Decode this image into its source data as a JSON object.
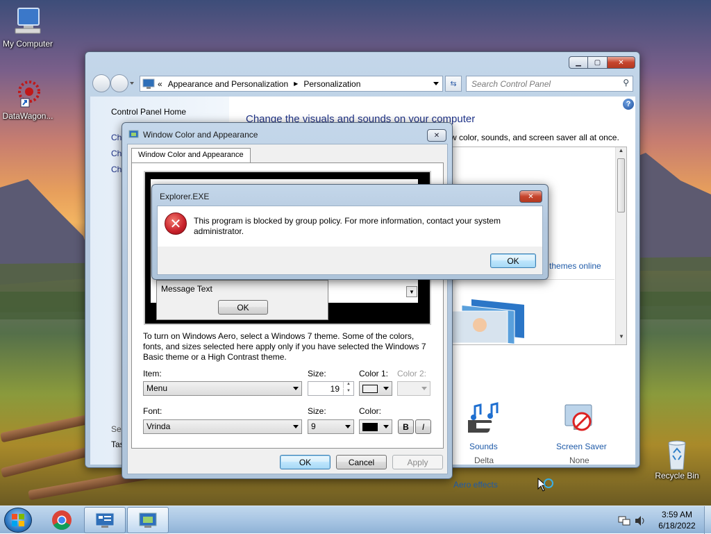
{
  "desktop": {
    "icons": [
      {
        "label": "My Computer",
        "icon": "computer-icon"
      },
      {
        "label": "DataWagon...",
        "icon": "datawagon-shortcut-icon"
      },
      {
        "label": "Recycle Bin",
        "icon": "recycle-bin-icon"
      }
    ]
  },
  "control_panel": {
    "address": {
      "prefix": "«",
      "crumb1": "Appearance and Personalization",
      "crumb2": "Personalization"
    },
    "search_placeholder": "Search Control Panel",
    "sidebar": {
      "home": "Control Panel Home",
      "link1": "Ch",
      "link2": "Ch",
      "link3": "Ch",
      "see_also": "See",
      "taskbar": "Tas"
    },
    "heading": "Change the visuals and sounds on your computer",
    "subheading": "w color, sounds, and screen saver all at once.",
    "themes_online": "themes online",
    "sounds": {
      "label": "Sounds",
      "value": "Delta"
    },
    "screen_saver": {
      "label": "Screen Saver",
      "value": "None"
    },
    "aero_effects": "Aero effects"
  },
  "appearance_dialog": {
    "title": "Window Color and Appearance",
    "tab": "Window Color and Appearance",
    "preview": {
      "message_text": "Message Text",
      "ok": "OK"
    },
    "description": "To turn on Windows Aero, select a Windows 7 theme.  Some of the colors, fonts, and sizes selected here apply only if you have selected the Windows 7 Basic theme or a High Contrast theme.",
    "item_label": "Item:",
    "item_value": "Menu",
    "size_label": "Size:",
    "size_value": "19",
    "color1_label": "Color 1:",
    "color2_label": "Color 2:",
    "font_label": "Font:",
    "font_value": "Vrinda",
    "font_size_label": "Size:",
    "font_size_value": "9",
    "font_color_label": "Color:",
    "bold": "B",
    "italic": "I",
    "ok": "OK",
    "cancel": "Cancel",
    "apply": "Apply"
  },
  "error_dialog": {
    "title": "Explorer.EXE",
    "message": "This program is blocked by group policy. For more information, contact your system administrator.",
    "ok": "OK"
  },
  "taskbar": {
    "time": "3:59 AM",
    "date": "6/18/2022"
  },
  "colors": {
    "link_blue": "#1e5aa8",
    "heading_blue": "#1e3287",
    "error_red": "#c8202a"
  }
}
